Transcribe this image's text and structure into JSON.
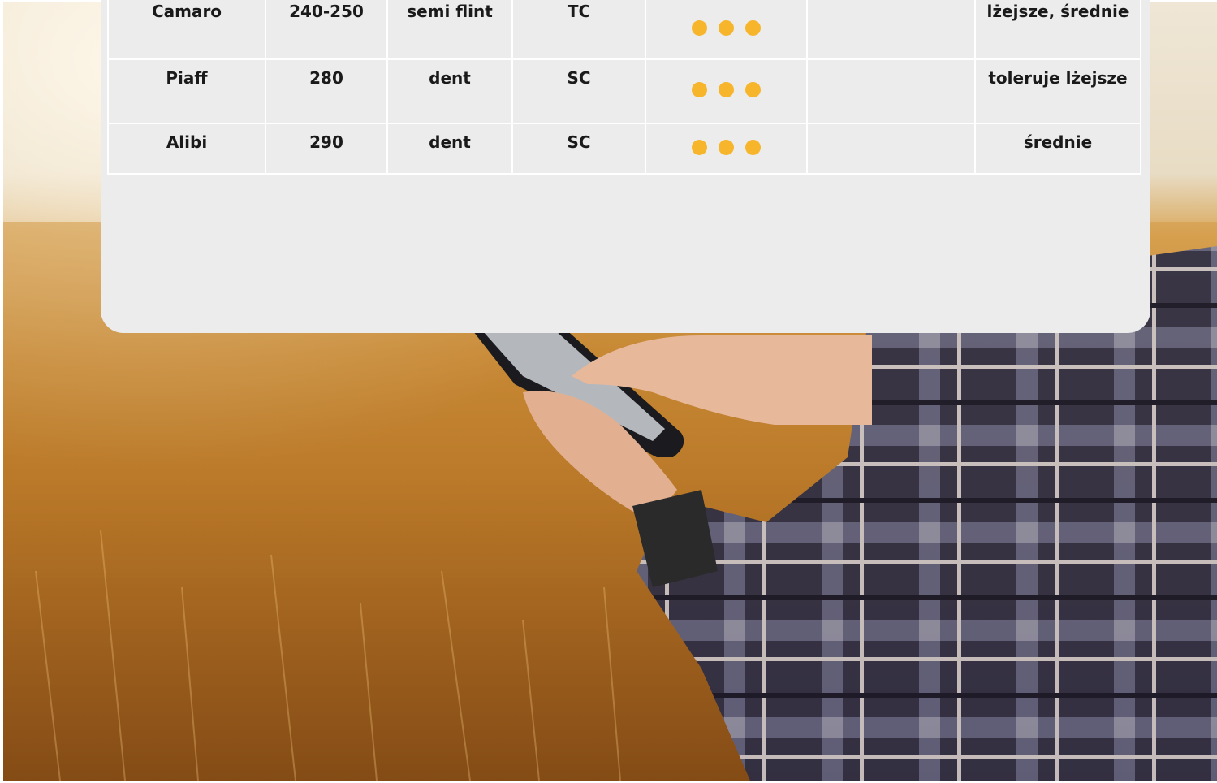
{
  "colors": {
    "card_background": "#ececec",
    "rating_dot": "#f7b52b",
    "grid_line": "#ffffff",
    "text": "#1a1a1a"
  },
  "photo": {
    "subject": "farmer-with-smartphone-in-wheat-field"
  },
  "table": {
    "rows": [
      {
        "name": "Camaro",
        "fao": "240-250",
        "grain_type": "semi flint",
        "hybrid": "TC",
        "rating_dots": 3,
        "extra": "",
        "soils": "lżejsze, średnie"
      },
      {
        "name": "Piaff",
        "fao": "280",
        "grain_type": "dent",
        "hybrid": "SC",
        "rating_dots": 3,
        "extra": "",
        "soils": "toleruje lżejsze"
      },
      {
        "name": "Alibi",
        "fao": "290",
        "grain_type": "dent",
        "hybrid": "SC",
        "rating_dots": 3,
        "extra": "",
        "soils": "średnie"
      }
    ]
  }
}
